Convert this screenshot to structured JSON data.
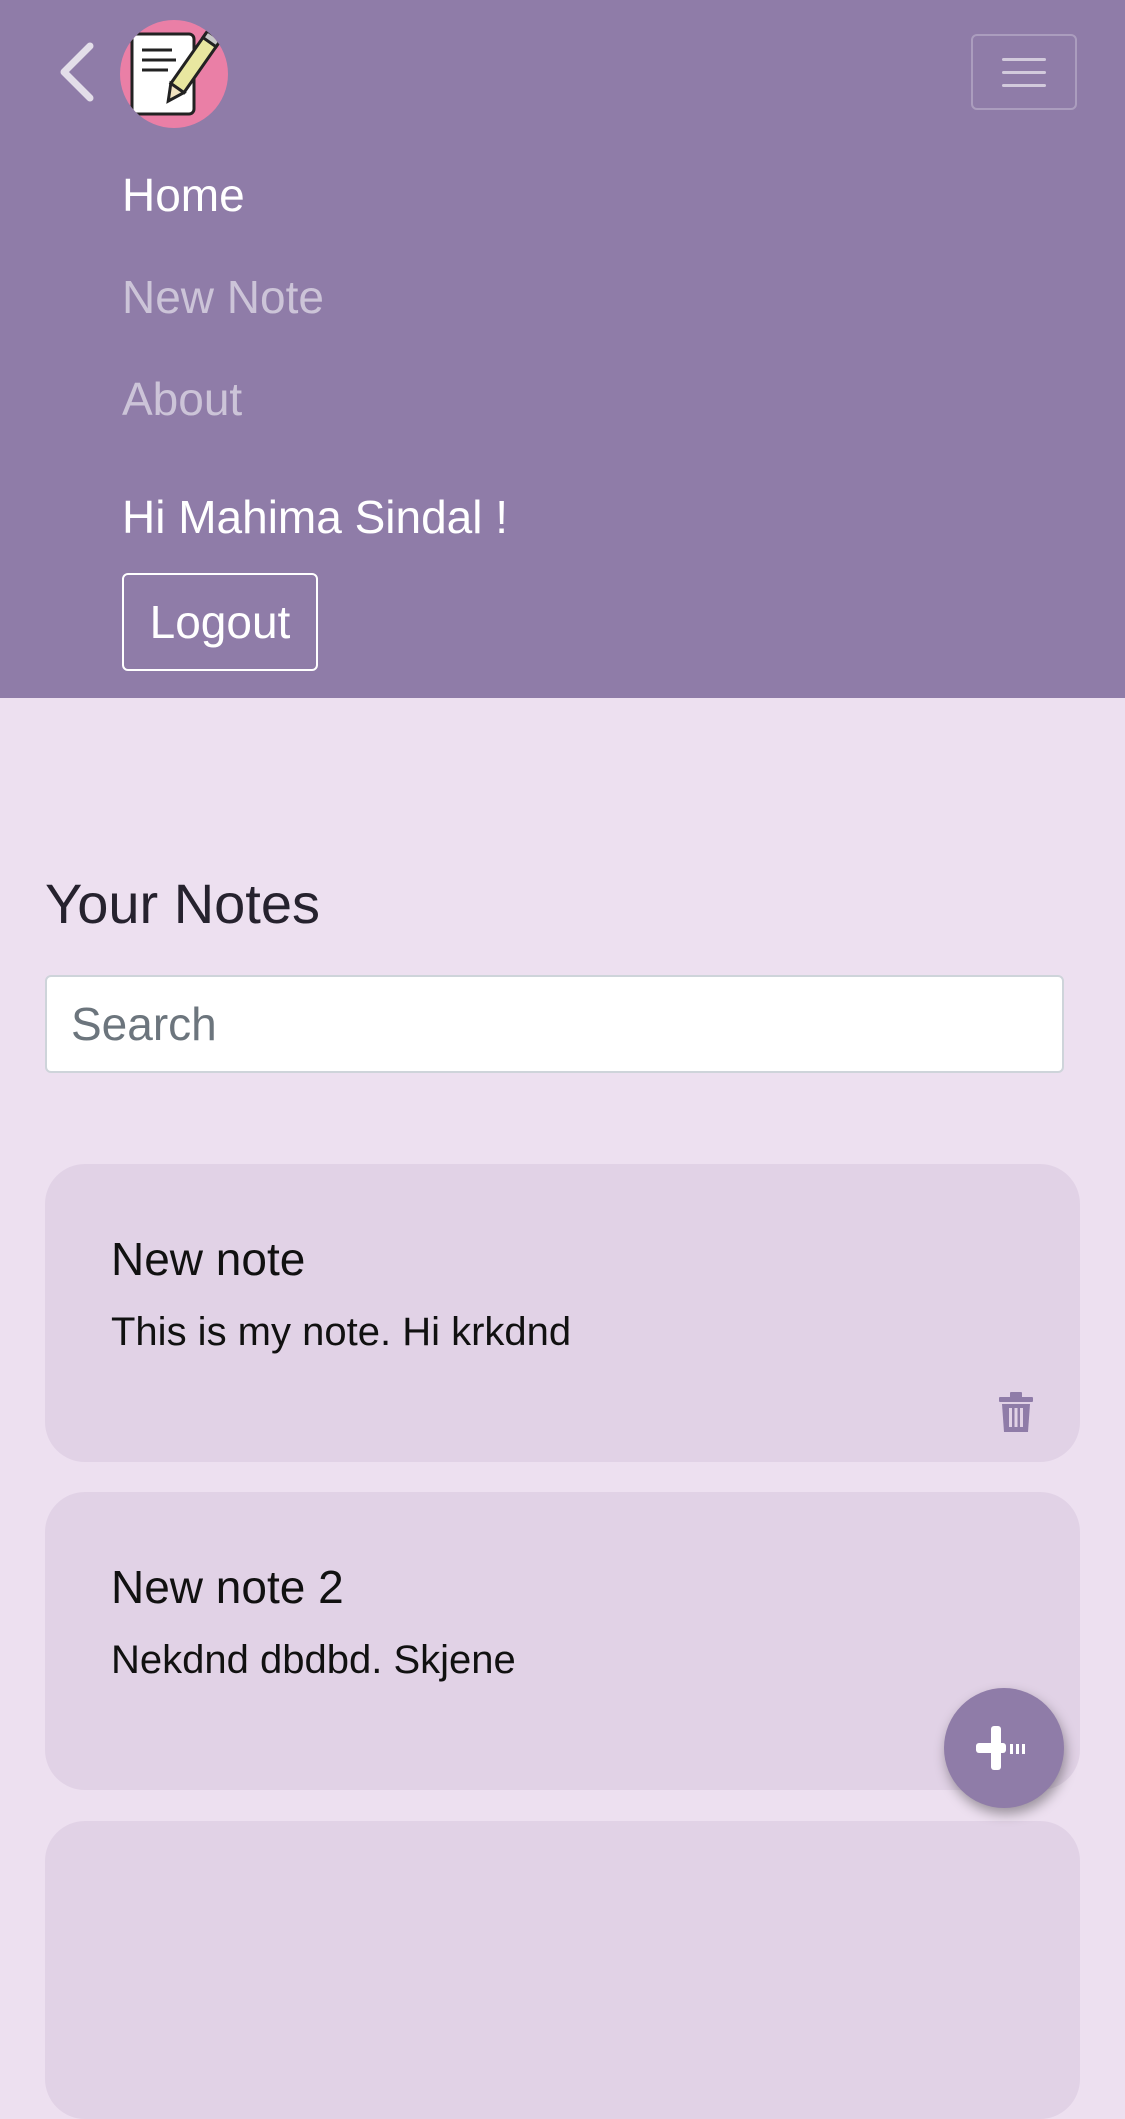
{
  "navbar": {
    "links": [
      {
        "label": "Home",
        "active": true
      },
      {
        "label": "New Note",
        "active": false
      },
      {
        "label": "About",
        "active": false
      }
    ],
    "greeting": "Hi Mahima Sindal !",
    "logout_label": "Logout",
    "logo_icon": "notepad-pencil-icon",
    "menu_icon": "hamburger-menu-icon",
    "back_icon": "chevron-left-icon"
  },
  "main": {
    "heading": "Your Notes",
    "search": {
      "placeholder": "Search",
      "value": ""
    },
    "notes": [
      {
        "title": "New note",
        "body": "This is my note. Hi krkdnd"
      },
      {
        "title": "New note 2",
        "body": "Nekdnd dbdbd. Skjene"
      },
      {
        "title": "",
        "body": ""
      }
    ],
    "delete_icon": "trash-icon",
    "add_icon": "add-note-icon"
  },
  "colors": {
    "navbar_bg": "#8f7ca8",
    "page_bg": "#ede0f0",
    "card_bg": "#e1d2e6",
    "logo_bg": "#ea7fa6",
    "accent": "#8f7ca8"
  }
}
